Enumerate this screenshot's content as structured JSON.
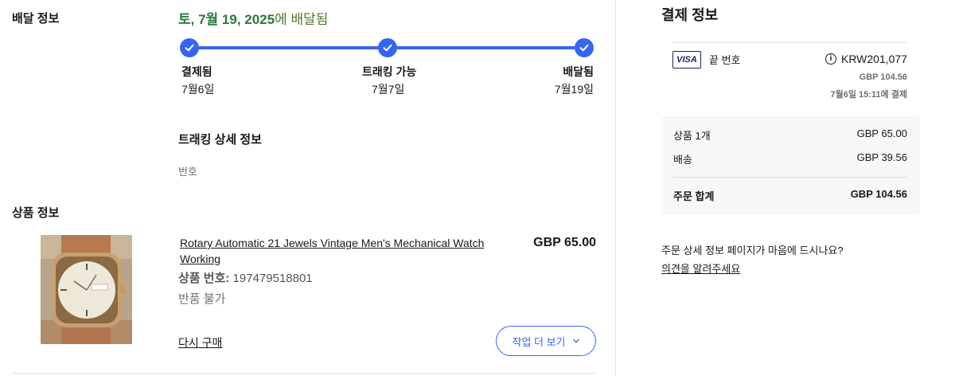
{
  "sections": {
    "delivery_label": "배달 정보",
    "product_label": "상품 정보"
  },
  "delivery": {
    "date": "토, 7월 19, 2025",
    "date_suffix": "에 배달됨",
    "steps": [
      {
        "title": "결제됨",
        "date": "7월6일"
      },
      {
        "title": "트래킹 가능",
        "date": "7월7일"
      },
      {
        "title": "배달됨",
        "date": "7월19일"
      }
    ],
    "progress_fraction": 1.0,
    "tracking_title": "트래킹 상세 정보",
    "tracking_number_label": "번호"
  },
  "product": {
    "title": "Rotary Automatic 21 Jewels Vintage Men's Mechanical Watch Working",
    "price": "GBP 65.00",
    "item_no_label": "상품 번호:",
    "item_no": "197479518801",
    "return_policy": "반품 불가",
    "buy_again": "다시 구매",
    "more_actions": "작업 더 보기"
  },
  "payment": {
    "title": "결제 정보",
    "card_brand": "VISA",
    "card_label": "끝 번호",
    "amount_krw": "KRW201,077",
    "amount_gbp": "GBP 104.56",
    "paid_at": "7월6일 15:11에 결제",
    "summary": {
      "items_label": "상품 1개",
      "items_value": "GBP 65.00",
      "shipping_label": "배송",
      "shipping_value": "GBP 39.56",
      "total_label": "주문 합계",
      "total_value": "GBP 104.56"
    }
  },
  "feedback": {
    "question": "주문 상세 정보 페이지가 마음에 드시나요?",
    "link": "의견을 알려주세요"
  },
  "colors": {
    "accent": "#3665f3",
    "delivered_green": "#2a7a3b"
  }
}
